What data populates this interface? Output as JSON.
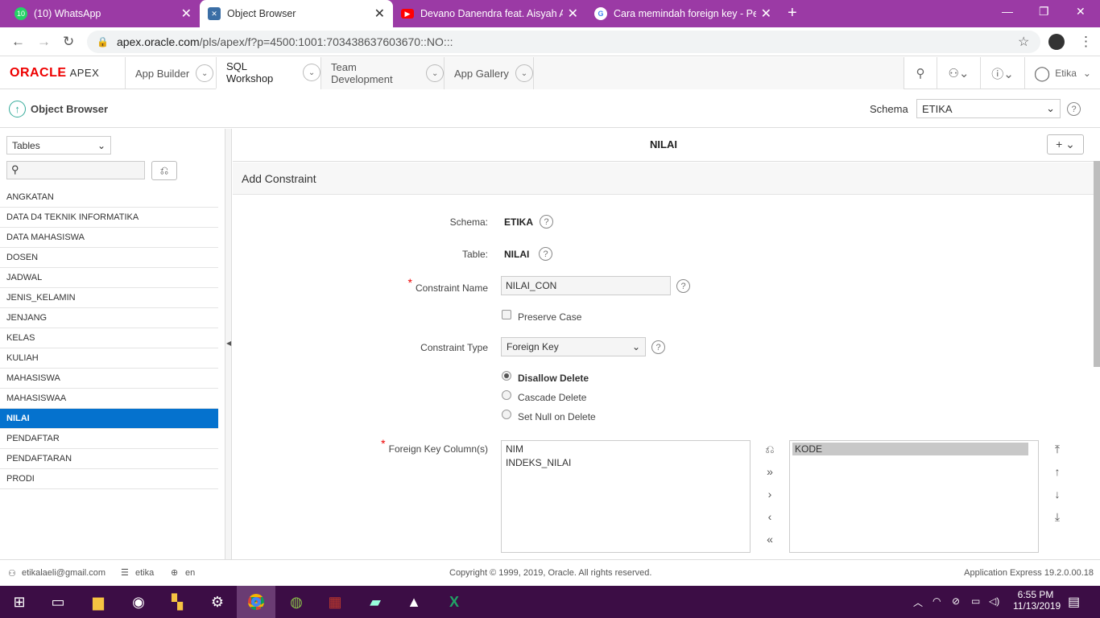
{
  "browser": {
    "tabs": [
      {
        "title": "(10) WhatsApp",
        "badge": "10"
      },
      {
        "title": "Object Browser"
      },
      {
        "title": "Devano Danendra feat. Aisyah Ad"
      },
      {
        "title": "Cara memindah foreign key - Per"
      }
    ],
    "url_host": "apex.oracle.com",
    "url_path": "/pls/apex/f?p=4500:1001:703438637603670::NO:::"
  },
  "apex": {
    "logo": "ORACLE",
    "logo_suffix": "APEX",
    "menus": [
      "App Builder",
      "SQL Workshop",
      "Team Development",
      "App Gallery"
    ],
    "user": "Etika"
  },
  "crumb": {
    "title": "Object Browser",
    "schema_label": "Schema",
    "schema_value": "ETIKA"
  },
  "left": {
    "object_type": "Tables",
    "search_placeholder": "",
    "tables": [
      "ANGKATAN",
      "DATA D4 TEKNIK INFORMATIKA",
      "DATA MAHASISWA",
      "DOSEN",
      "JADWAL",
      "JENIS_KELAMIN",
      "JENJANG",
      "KELAS",
      "KULIAH",
      "MAHASISWA",
      "MAHASISWAA",
      "NILAI",
      "PENDAFTAR",
      "PENDAFTARAN",
      "PRODI"
    ],
    "selected": "NILAI"
  },
  "main": {
    "object_title": "NILAI",
    "region_title": "Add Constraint",
    "schema_label": "Schema:",
    "schema_value": "ETIKA",
    "table_label": "Table:",
    "table_value": "NILAI",
    "constraint_name_label": "Constraint Name",
    "constraint_name_value": "NILAI_CON",
    "preserve_case_label": "Preserve Case",
    "constraint_type_label": "Constraint Type",
    "constraint_type_value": "Foreign Key",
    "delete_options": [
      "Disallow Delete",
      "Cascade Delete",
      "Set Null on Delete"
    ],
    "selected_delete_option": "Disallow Delete",
    "fk_label": "Foreign Key Column(s)",
    "fk_available": [
      "NIM",
      "INDEKS_NILAI"
    ],
    "fk_selected": [
      "KODE"
    ]
  },
  "footer": {
    "email": "etikalaeli@gmail.com",
    "workspace": "etika",
    "lang": "en",
    "copyright": "Copyright © 1999, 2019, Oracle. All rights reserved.",
    "version": "Application Express 19.2.0.00.18"
  },
  "taskbar": {
    "time": "6:55 PM",
    "date": "11/13/2019"
  }
}
